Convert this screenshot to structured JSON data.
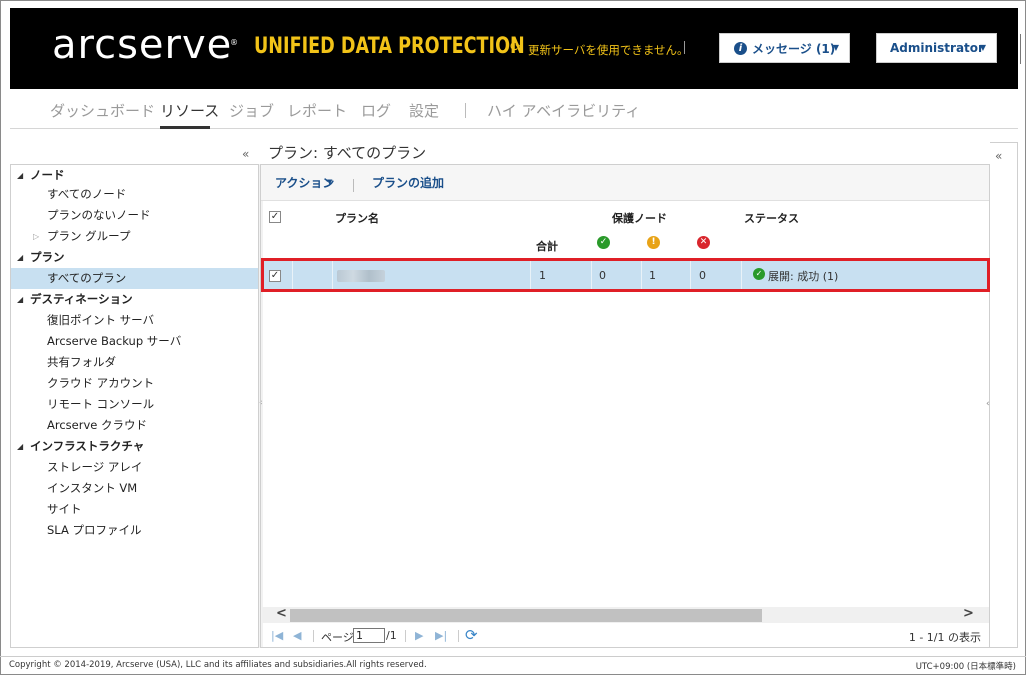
{
  "header": {
    "logo": "arcserve",
    "logo_mark": "®",
    "product": "UNIFIED DATA PROTECTION",
    "update_notice": "更新サーバを使用できません。",
    "messages_button": "メッセージ (1)",
    "user_button": "Administrator"
  },
  "nav": {
    "items": [
      "ダッシュボード",
      "リソース",
      "ジョブ",
      "レポート",
      "ログ",
      "設定",
      "ハイ アベイラビリティ"
    ],
    "active": "リソース"
  },
  "sidebar": {
    "collapse_glyph": "«",
    "tree": [
      {
        "label": "ノード",
        "kind": "cat"
      },
      {
        "label": "すべてのノード",
        "kind": "item"
      },
      {
        "label": "プランのないノード",
        "kind": "item"
      },
      {
        "label": "プラン グループ",
        "kind": "sub"
      },
      {
        "label": "プラン",
        "kind": "cat"
      },
      {
        "label": "すべてのプラン",
        "kind": "item",
        "selected": true
      },
      {
        "label": "デスティネーション",
        "kind": "cat"
      },
      {
        "label": "復旧ポイント サーバ",
        "kind": "item"
      },
      {
        "label": "Arcserve Backup サーバ",
        "kind": "item"
      },
      {
        "label": "共有フォルダ",
        "kind": "item"
      },
      {
        "label": "クラウド アカウント",
        "kind": "item"
      },
      {
        "label": "リモート コンソール",
        "kind": "item"
      },
      {
        "label": "Arcserve クラウド",
        "kind": "item"
      },
      {
        "label": "インフラストラクチャ",
        "kind": "cat"
      },
      {
        "label": "ストレージ アレイ",
        "kind": "item"
      },
      {
        "label": "インスタント VM",
        "kind": "item"
      },
      {
        "label": "サイト",
        "kind": "item"
      },
      {
        "label": "SLA プロファイル",
        "kind": "item"
      }
    ]
  },
  "main": {
    "title": "プラン: すべてのプラン",
    "toolbar": {
      "action_label": "アクション",
      "add_plan_label": "プランの追加"
    },
    "columns": {
      "plan_name": "プラン名",
      "protected_nodes": "保護ノード",
      "status": "ステータス",
      "total": "合計"
    },
    "rows": [
      {
        "checked": true,
        "plan_name_redacted": true,
        "total": "1",
        "success": "0",
        "warning": "1",
        "error": "0",
        "status": "展開: 成功 (1)"
      }
    ],
    "pager": {
      "page_label": "ページ",
      "page_value": "1",
      "page_total": "/1",
      "count_text": "1 - 1/1 の表示"
    }
  },
  "footer": {
    "copyright": "Copyright © 2014-2019, Arcserve (USA), LLC and its affiliates and subsidiaries.All rights reserved.",
    "timezone": "UTC+09:00 (日本標準時)"
  },
  "colors": {
    "brand_yellow": "#f2c318",
    "link_blue": "#1a4f8a",
    "selection": "#c8e0f1",
    "success": "#2a9a2a",
    "warning": "#e8a317",
    "error": "#d9262d",
    "highlight_border": "#e01f26"
  }
}
